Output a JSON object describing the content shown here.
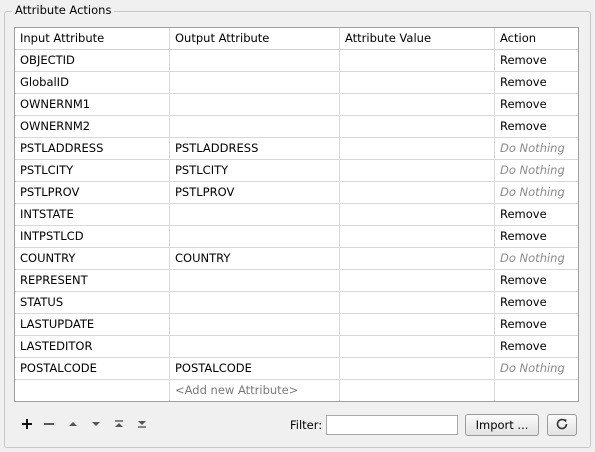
{
  "group": {
    "title": "Attribute Actions"
  },
  "table": {
    "columns": [
      "Input Attribute",
      "Output Attribute",
      "Attribute Value",
      "Action"
    ],
    "rows": [
      {
        "input": "OBJECTID",
        "output": "",
        "value": "",
        "action": "Remove"
      },
      {
        "input": "GlobalID",
        "output": "",
        "value": "",
        "action": "Remove"
      },
      {
        "input": "OWNERNM1",
        "output": "",
        "value": "",
        "action": "Remove"
      },
      {
        "input": "OWNERNM2",
        "output": "",
        "value": "",
        "action": "Remove"
      },
      {
        "input": "PSTLADDRESS",
        "output": "PSTLADDRESS",
        "value": "",
        "action": "Do Nothing"
      },
      {
        "input": "PSTLCITY",
        "output": "PSTLCITY",
        "value": "",
        "action": "Do Nothing"
      },
      {
        "input": "PSTLPROV",
        "output": "PSTLPROV",
        "value": "",
        "action": "Do Nothing"
      },
      {
        "input": "INTSTATE",
        "output": "",
        "value": "",
        "action": "Remove"
      },
      {
        "input": "INTPSTLCD",
        "output": "",
        "value": "",
        "action": "Remove"
      },
      {
        "input": "COUNTRY",
        "output": "COUNTRY",
        "value": "",
        "action": "Do Nothing"
      },
      {
        "input": "REPRESENT",
        "output": "",
        "value": "",
        "action": "Remove"
      },
      {
        "input": "STATUS",
        "output": "",
        "value": "",
        "action": "Remove"
      },
      {
        "input": "LASTUPDATE",
        "output": "",
        "value": "",
        "action": "Remove"
      },
      {
        "input": "LASTEDITOR",
        "output": "",
        "value": "",
        "action": "Remove"
      },
      {
        "input": "POSTALCODE",
        "output": "POSTALCODE",
        "value": "",
        "action": "Do Nothing"
      }
    ],
    "add_new_placeholder": "<Add new Attribute>"
  },
  "toolbar": {
    "add_icon": "plus-icon",
    "remove_icon": "minus-icon",
    "move_up_icon": "move-up-icon",
    "move_down_icon": "move-down-icon",
    "move_top_icon": "move-to-top-icon",
    "move_bottom_icon": "move-to-bottom-icon",
    "filter_label": "Filter:",
    "filter_value": "",
    "import_label": "Import ...",
    "refresh_icon": "refresh-icon"
  }
}
